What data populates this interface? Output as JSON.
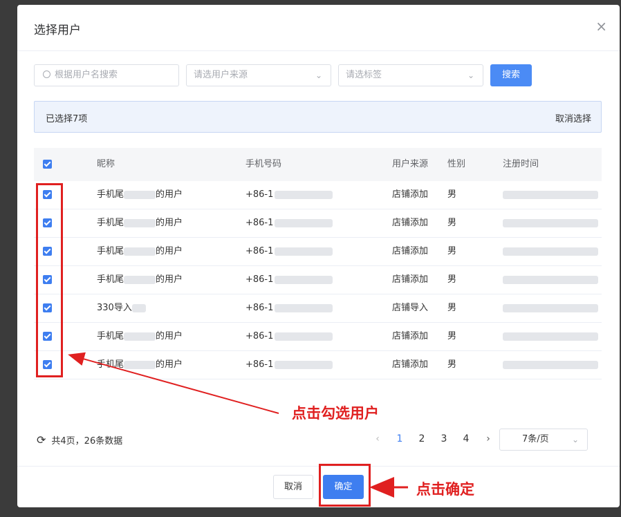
{
  "dialog": {
    "title": "选择用户",
    "close_icon": "×"
  },
  "filters": {
    "search_placeholder": "根据用户名搜索",
    "source_placeholder": "请选用户来源",
    "tag_placeholder": "请选标签",
    "search_button": "搜索"
  },
  "selection": {
    "count_text": "已选择7项",
    "cancel_text": "取消选择"
  },
  "table": {
    "headers": {
      "name": "昵称",
      "phone": "手机号码",
      "source": "用户来源",
      "gender": "性别",
      "time": "注册时间"
    },
    "rows": [
      {
        "name_prefix": "手机尾",
        "name_suffix": "的用户",
        "phone": "+86-1",
        "source": "店铺添加",
        "gender": "男"
      },
      {
        "name_prefix": "手机尾",
        "name_suffix": "的用户",
        "phone": "+86-1",
        "source": "店铺添加",
        "gender": "男"
      },
      {
        "name_prefix": "手机尾",
        "name_suffix": "的用户",
        "phone": "+86-1",
        "source": "店铺添加",
        "gender": "男"
      },
      {
        "name_prefix": "手机尾",
        "name_suffix": "的用户",
        "phone": "+86-1",
        "source": "店铺添加",
        "gender": "男"
      },
      {
        "name_prefix": "330导入",
        "name_suffix": "",
        "phone": "+86-1",
        "source": "店铺导入",
        "gender": "男"
      },
      {
        "name_prefix": "手机尾",
        "name_suffix": "的用户",
        "phone": "+86-1",
        "source": "店铺添加",
        "gender": "男"
      },
      {
        "name_prefix": "手机尾",
        "name_suffix": "的用户",
        "phone": "+86-1",
        "source": "店铺添加",
        "gender": "男"
      }
    ]
  },
  "pagination": {
    "summary": "共4页，26条数据",
    "pages": [
      "1",
      "2",
      "3",
      "4"
    ],
    "current_page": "1",
    "prev": "‹",
    "next": "›",
    "page_size": "7条/页"
  },
  "footer": {
    "cancel": "取消",
    "confirm": "确定"
  },
  "annotations": {
    "check_users": "点击勾选用户",
    "click_confirm": "点击确定"
  },
  "colors": {
    "primary": "#3e7ef0",
    "annotation_red": "#e02020"
  }
}
